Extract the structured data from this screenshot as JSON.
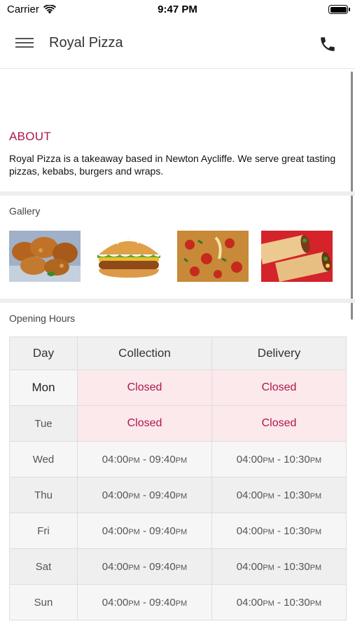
{
  "status_bar": {
    "carrier": "Carrier",
    "time": "9:47 PM"
  },
  "header": {
    "title": "Royal Pizza",
    "menu_icon": "hamburger-menu-icon",
    "call_icon": "phone-icon"
  },
  "about": {
    "heading": "ABOUT",
    "text": "Royal Pizza is a takeaway based in Newton Aycliffe. We serve great tasting pizzas, kebabs, burgers and wraps."
  },
  "gallery": {
    "label": "Gallery",
    "images": [
      "fried-chicken",
      "burger",
      "pizza",
      "wraps"
    ]
  },
  "opening_hours": {
    "label": "Opening Hours",
    "headers": {
      "day": "Day",
      "collection": "Collection",
      "delivery": "Delivery"
    },
    "rows": [
      {
        "day": "Mon",
        "collection": "Closed",
        "delivery": "Closed"
      },
      {
        "day": "Tue",
        "collection": "Closed",
        "delivery": "Closed"
      },
      {
        "day": "Wed",
        "c_start": "04:00",
        "c_start_ampm": "PM",
        "c_end": "09:40",
        "c_end_ampm": "PM",
        "d_start": "04:00",
        "d_start_ampm": "PM",
        "d_end": "10:30",
        "d_end_ampm": "PM"
      },
      {
        "day": "Thu",
        "c_start": "04:00",
        "c_start_ampm": "PM",
        "c_end": "09:40",
        "c_end_ampm": "PM",
        "d_start": "04:00",
        "d_start_ampm": "PM",
        "d_end": "10:30",
        "d_end_ampm": "PM"
      },
      {
        "day": "Fri",
        "c_start": "04:00",
        "c_start_ampm": "PM",
        "c_end": "09:40",
        "c_end_ampm": "PM",
        "d_start": "04:00",
        "d_start_ampm": "PM",
        "d_end": "10:30",
        "d_end_ampm": "PM"
      },
      {
        "day": "Sat",
        "c_start": "04:00",
        "c_start_ampm": "PM",
        "c_end": "09:40",
        "c_end_ampm": "PM",
        "d_start": "04:00",
        "d_start_ampm": "PM",
        "d_end": "10:30",
        "d_end_ampm": "PM"
      },
      {
        "day": "Sun",
        "c_start": "04:00",
        "c_start_ampm": "PM",
        "c_end": "09:40",
        "c_end_ampm": "PM",
        "d_start": "04:00",
        "d_start_ampm": "PM",
        "d_end": "10:30",
        "d_end_ampm": "PM"
      }
    ]
  },
  "colors": {
    "accent": "#b0154a",
    "closed_bg": "#fce9ec",
    "header_bg": "#f0f0f0"
  }
}
